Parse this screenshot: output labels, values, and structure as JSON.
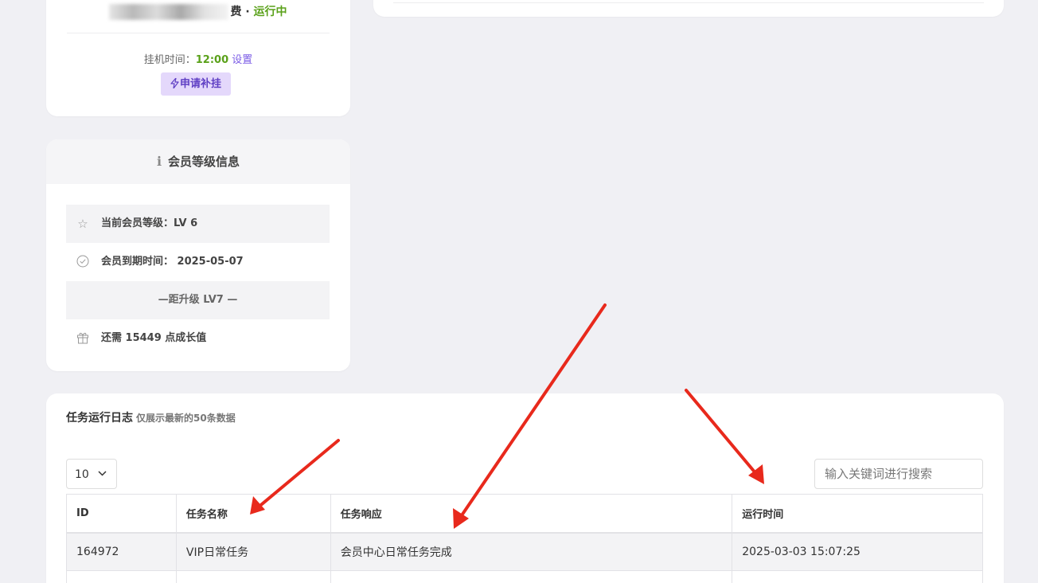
{
  "account": {
    "status_suffix": "费 · ",
    "status": "运行中",
    "hang_label": "挂机时间：",
    "hang_time": "12:00",
    "settings_link": "设置",
    "apply_button": "申请补挂"
  },
  "member": {
    "title": "会员等级信息",
    "level_row": "当前会员等级：LV 6",
    "expire_row": "会员到期时间： 2025-05-07",
    "upgrade_row": "—距升级 LV7 —",
    "need_row": "还需 15449 点成长值"
  },
  "log": {
    "title": "任务运行日志",
    "subtitle": "仅展示最新的50条数据",
    "page_size": "10",
    "search_placeholder": "输入关键词进行搜索",
    "columns": [
      "ID",
      "任务名称",
      "任务响应",
      "运行时间"
    ],
    "rows": [
      [
        "164972",
        "VIP日常任务",
        "会员中心日常任务完成",
        "2025-03-03 15:07:25"
      ]
    ]
  },
  "colors": {
    "accent_green": "#5aa11a",
    "accent_purple": "#7b5ce6",
    "annotation_red": "#e8291c"
  }
}
